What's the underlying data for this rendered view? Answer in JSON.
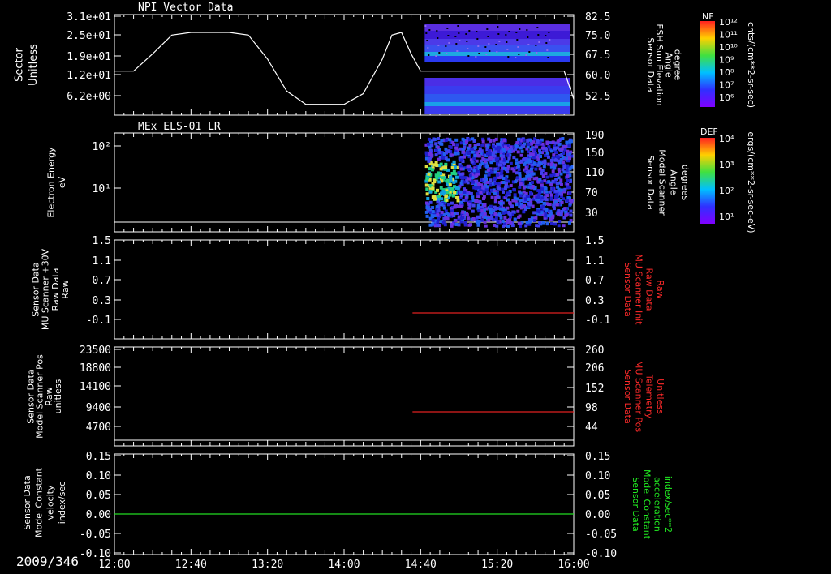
{
  "colors": {
    "background": "#000000",
    "axis": "#ffffff",
    "red_trace": "#ff2020",
    "green_trace": "#22dd22"
  },
  "date_label": "2009/346",
  "time_ticks": [
    "12:00",
    "12:40",
    "13:20",
    "14:00",
    "14:40",
    "15:20",
    "16:00"
  ],
  "chart_data": [
    {
      "type": "line",
      "title": "NPI Vector Data",
      "ylabel": [
        "Sector",
        "Unitless"
      ],
      "yticks": [
        "3.1e+01",
        "2.5e+01",
        "1.9e+01",
        "1.2e+01",
        "6.2e+00"
      ],
      "right_ylabel": [
        "Sensor Data",
        "ESH Sun Elevation",
        "Angle",
        "degree"
      ],
      "right_yticks": [
        "82.5",
        "75.0",
        "67.5",
        "60.0",
        "52.5"
      ],
      "series": [
        {
          "x": [
            "12:00",
            "12:10",
            "12:20",
            "12:30",
            "12:40",
            "13:00",
            "13:10",
            "13:20",
            "13:30",
            "13:40",
            "14:00",
            "14:10",
            "14:20",
            "14:25",
            "14:30",
            "14:35",
            "14:40",
            "15:00",
            "15:40",
            "15:55",
            "16:00"
          ],
          "values": [
            13.5,
            13.5,
            20,
            27,
            28,
            28,
            27,
            18,
            6,
            1,
            1,
            5,
            18,
            27,
            28,
            20,
            13.5,
            13.5,
            13.5,
            13.5,
            3
          ]
        }
      ],
      "spectrogram": "present from 14:40 to 16:00",
      "colorbar": {
        "label": "NF",
        "unit": "cnts/(cm**2-sr-sec)",
        "ticks": [
          "10¹²",
          "10¹¹",
          "10¹⁰",
          "10⁹",
          "10⁸",
          "10⁷",
          "10⁶"
        ]
      }
    },
    {
      "type": "heatmap",
      "title": "MEx ELS-01 LR",
      "ylabel": [
        "Electron Energy",
        "eV"
      ],
      "yticks": [
        "10²",
        "10¹"
      ],
      "right_ylabel": [
        "Sensor Data",
        "Model Scanner",
        "Angle",
        "degrees"
      ],
      "right_yticks": [
        "190",
        "150",
        "110",
        "70",
        "30"
      ],
      "colorbar": {
        "label": "DEF",
        "unit": "ergs/(cm**2-sr-sec-eV)",
        "ticks": [
          "10⁴",
          "10³",
          "10²",
          "10¹"
        ]
      }
    },
    {
      "type": "line",
      "ylabel": [
        "Sensor Data",
        "MU Scanner +30V",
        "Raw Data",
        "Raw"
      ],
      "yticks": [
        "1.5",
        "1.1",
        "0.7",
        "0.3",
        "-0.1"
      ],
      "right_ylabel": [
        "Sensor Data",
        "MU Scanner Init",
        "Raw Data",
        "Raw"
      ],
      "right_yticks": [
        "1.5",
        "1.1",
        "0.7",
        "0.3",
        "-0.1"
      ],
      "series": [
        {
          "x": [
            "14:40",
            "16:00"
          ],
          "values": [
            -0.1,
            -0.1
          ]
        }
      ]
    },
    {
      "type": "line",
      "ylabel": [
        "Sensor Data",
        "Model Scanner Pos",
        "Raw",
        "unitless"
      ],
      "yticks": [
        "23500",
        "18800",
        "14100",
        "9400",
        "4700"
      ],
      "right_ylabel": [
        "Sensor Data",
        "MU Scanner Pos",
        "Telemetry",
        "Unitless"
      ],
      "right_yticks": [
        "260",
        "206",
        "152",
        "98",
        "44"
      ],
      "series": [
        {
          "x": [
            "14:40",
            "16:00"
          ],
          "values": [
            82,
            82
          ]
        }
      ]
    },
    {
      "type": "line",
      "ylabel": [
        "Sensor Data",
        "Model Constant",
        "velocity",
        "index/sec"
      ],
      "yticks": [
        "0.15",
        "0.10",
        "0.05",
        "0.00",
        "-0.05",
        "-0.10"
      ],
      "right_ylabel": [
        "Sensor Data",
        "Model Constant",
        "acceleration",
        "index/sec**2"
      ],
      "right_yticks": [
        "0.15",
        "0.10",
        "0.05",
        "0.00",
        "-0.05",
        "-0.10"
      ],
      "series": [
        {
          "x": [
            "12:00",
            "16:00"
          ],
          "values": [
            0,
            0
          ]
        }
      ]
    }
  ]
}
